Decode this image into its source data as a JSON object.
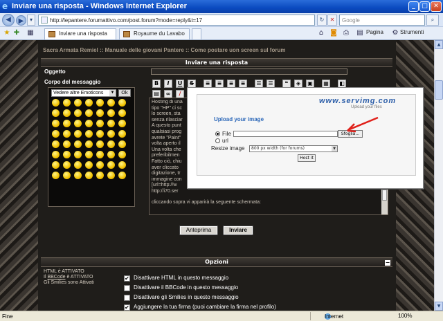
{
  "window": {
    "title": "Inviare una risposta - Windows Internet Explorer",
    "buttons": {
      "minimize": "_",
      "maximize": "□",
      "close": "✕"
    }
  },
  "addressbar": {
    "url": "http://lepantere.forumattivo.com/post.forum?mode=reply&t=17",
    "search_placeholder": "Google"
  },
  "tabs": [
    {
      "label": "Inviare una risposta"
    },
    {
      "label": "Royaume du Lavabo"
    }
  ],
  "commandbar": {
    "page_label": "Pagina",
    "tools_label": "Strumenti"
  },
  "forum": {
    "breadcrumb": "Sacra Armata Remiel :: Manuale delle giovani Pantere :: Come postare uon screen sul forum",
    "header": "Inviare una risposta",
    "subject_label": "Oggetto",
    "body_label": "Corpo del messaggio",
    "emoticons_select": "Vedere altre Emoticons",
    "emoticons_ok": "Ok",
    "toolbar": [
      "B",
      "I",
      "U",
      "S"
    ],
    "message_lines": [
      "Hosting di una",
      "tipo \"HP\" ci sc",
      "lo screen, sta",
      "senza rilasciar",
      "A questo punt",
      "qualsiasi prog",
      "avrete \"Paint\"",
      "volta aperto il",
      "Una volta che",
      "preferibilmen",
      "Fatto ciò, chiu",
      "aver cliccato",
      "digitazione, tr",
      "immagine con",
      "[url=http://w",
      "http://i70.ser"
    ],
    "message_tail": "cliccando sopra vi apparirà la seguente schermata:",
    "preview_button": "Anteprima",
    "send_button": "Inviare",
    "options_header": "Opzioni",
    "info": {
      "html": "HTML è ATTIVATO",
      "bbcode_prefix": "Il",
      "bbcode_link": "BBCode",
      "bbcode_suffix": "è ATTIVATO",
      "smilies": "Gli Smilies sono Attivati"
    },
    "options": [
      {
        "label": "Disattivare HTML in questo messaggio",
        "checked": true
      },
      {
        "label": "Disattivare il BBCode in questo messaggio",
        "checked": false
      },
      {
        "label": "Disattivare gli Smilies in questo messaggio",
        "checked": false
      },
      {
        "label": "Aggiungere la tua firma (puoi cambiare la firma nel profilo)",
        "checked": true
      }
    ]
  },
  "popup": {
    "logo": "www.servimg.com",
    "tagline": "Upload your files",
    "title": "Upload your image",
    "file_label": "File",
    "browse": "Sfoglia...",
    "url_label": "url",
    "resize_label": "Resize image",
    "resize_value": "800 px width (for forums)",
    "host_button": "Host it"
  },
  "statusbar": {
    "text": "Fine",
    "zone": "Internet",
    "zoom": "100%"
  },
  "colors": {
    "accent_red": "#e0201a",
    "title_blue": "#0a4ac0"
  }
}
